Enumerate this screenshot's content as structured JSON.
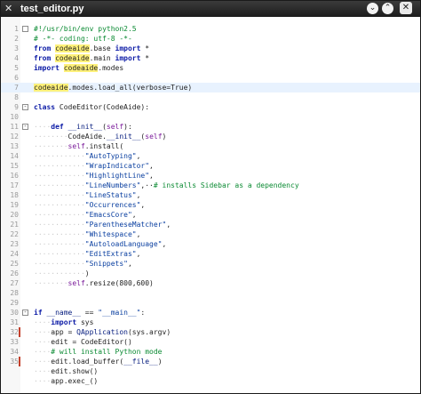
{
  "window": {
    "title": "test_editor.py",
    "app_icon": "x-logo-icon",
    "buttons": [
      {
        "name": "minimize-button",
        "glyph": "⌄"
      },
      {
        "name": "maximize-button",
        "glyph": "⌃"
      },
      {
        "name": "close-button",
        "glyph": "✕"
      }
    ]
  },
  "colors": {
    "keyword": "#0b1aa6",
    "comment": "#0a8a32",
    "string": "#0a3fa0",
    "self": "#7a1a9a",
    "highlight_word": "#fff17a",
    "current_line": "#e8f2fe"
  },
  "editor": {
    "highlighted_line": 7,
    "changed_lines": [
      32,
      35
    ],
    "folded_markers": [
      {
        "line": 1,
        "glyph": ""
      },
      {
        "line": 9,
        "glyph": "-"
      },
      {
        "line": 11,
        "glyph": "-"
      },
      {
        "line": 30,
        "glyph": "-"
      }
    ],
    "lines": [
      {
        "n": "1",
        "tokens": [
          {
            "t": "#!/usr/bin/env python2.5",
            "c": "comment"
          }
        ]
      },
      {
        "n": "2",
        "tokens": [
          {
            "t": "# -*- coding: utf-8 -*-",
            "c": "comment"
          }
        ]
      },
      {
        "n": "3",
        "tokens": [
          {
            "t": "from ",
            "c": "keyword"
          },
          {
            "t": "codeaide",
            "c": "mark"
          },
          {
            "t": ".base ",
            "c": ""
          },
          {
            "t": "import",
            "c": "keyword"
          },
          {
            "t": " *",
            "c": ""
          }
        ]
      },
      {
        "n": "4",
        "tokens": [
          {
            "t": "from ",
            "c": "keyword"
          },
          {
            "t": "codeaide",
            "c": "mark"
          },
          {
            "t": ".main ",
            "c": ""
          },
          {
            "t": "import",
            "c": "keyword"
          },
          {
            "t": " *",
            "c": ""
          }
        ]
      },
      {
        "n": "5",
        "tokens": [
          {
            "t": "import ",
            "c": "keyword"
          },
          {
            "t": "codeaide",
            "c": "mark"
          },
          {
            "t": ".modes",
            "c": ""
          }
        ]
      },
      {
        "n": "6",
        "tokens": []
      },
      {
        "n": "7",
        "tokens": [
          {
            "t": "codeaide",
            "c": "mark"
          },
          {
            "t": ".modes.load_all(verbose=True)",
            "c": ""
          }
        ]
      },
      {
        "n": "8",
        "tokens": []
      },
      {
        "n": "9",
        "tokens": [
          {
            "t": "class ",
            "c": "keyword"
          },
          {
            "t": "CodeEditor(CodeAide):",
            "c": ""
          }
        ]
      },
      {
        "n": "10",
        "tokens": []
      },
      {
        "n": "11",
        "tokens": [
          {
            "t": "····",
            "c": "ws"
          },
          {
            "t": "def ",
            "c": "keyword"
          },
          {
            "t": "__init__",
            "c": "func"
          },
          {
            "t": "(",
            "c": ""
          },
          {
            "t": "self",
            "c": "self"
          },
          {
            "t": "):",
            "c": ""
          }
        ]
      },
      {
        "n": "12",
        "tokens": [
          {
            "t": "········",
            "c": "ws"
          },
          {
            "t": "CodeAide.",
            "c": ""
          },
          {
            "t": "__init__",
            "c": "func"
          },
          {
            "t": "(",
            "c": ""
          },
          {
            "t": "self",
            "c": "self"
          },
          {
            "t": ")",
            "c": ""
          }
        ]
      },
      {
        "n": "13",
        "tokens": [
          {
            "t": "········",
            "c": "ws"
          },
          {
            "t": "self",
            "c": "self"
          },
          {
            "t": ".install(",
            "c": ""
          }
        ]
      },
      {
        "n": "14",
        "tokens": [
          {
            "t": "············",
            "c": "ws"
          },
          {
            "t": "\"AutoTyping\"",
            "c": "string"
          },
          {
            "t": ",",
            "c": ""
          }
        ]
      },
      {
        "n": "15",
        "tokens": [
          {
            "t": "············",
            "c": "ws"
          },
          {
            "t": "\"WrapIndicator\"",
            "c": "string"
          },
          {
            "t": ",",
            "c": ""
          }
        ]
      },
      {
        "n": "16",
        "tokens": [
          {
            "t": "············",
            "c": "ws"
          },
          {
            "t": "\"HighlightLine\"",
            "c": "string"
          },
          {
            "t": ",",
            "c": ""
          }
        ]
      },
      {
        "n": "17",
        "tokens": [
          {
            "t": "············",
            "c": "ws"
          },
          {
            "t": "\"LineNumbers\"",
            "c": "string"
          },
          {
            "t": ",··",
            "c": ""
          },
          {
            "t": "# installs Sidebar as a dependency",
            "c": "comment"
          }
        ]
      },
      {
        "n": "18",
        "tokens": [
          {
            "t": "············",
            "c": "ws"
          },
          {
            "t": "\"LineStatus\"",
            "c": "string"
          },
          {
            "t": ",",
            "c": ""
          }
        ]
      },
      {
        "n": "19",
        "tokens": [
          {
            "t": "············",
            "c": "ws"
          },
          {
            "t": "\"Occurrences\"",
            "c": "string"
          },
          {
            "t": ",",
            "c": ""
          }
        ]
      },
      {
        "n": "20",
        "tokens": [
          {
            "t": "············",
            "c": "ws"
          },
          {
            "t": "\"EmacsCore\"",
            "c": "string"
          },
          {
            "t": ",",
            "c": ""
          }
        ]
      },
      {
        "n": "21",
        "tokens": [
          {
            "t": "············",
            "c": "ws"
          },
          {
            "t": "\"ParentheseMatcher\"",
            "c": "string"
          },
          {
            "t": ",",
            "c": ""
          }
        ]
      },
      {
        "n": "22",
        "tokens": [
          {
            "t": "············",
            "c": "ws"
          },
          {
            "t": "\"Whitespace\"",
            "c": "string"
          },
          {
            "t": ",",
            "c": ""
          }
        ]
      },
      {
        "n": "23",
        "tokens": [
          {
            "t": "············",
            "c": "ws"
          },
          {
            "t": "\"AutoloadLanguage\"",
            "c": "string"
          },
          {
            "t": ",",
            "c": ""
          }
        ]
      },
      {
        "n": "24",
        "tokens": [
          {
            "t": "············",
            "c": "ws"
          },
          {
            "t": "\"EditExtras\"",
            "c": "string"
          },
          {
            "t": ",",
            "c": ""
          }
        ]
      },
      {
        "n": "25",
        "tokens": [
          {
            "t": "············",
            "c": "ws"
          },
          {
            "t": "\"Snippets\"",
            "c": "string"
          },
          {
            "t": ",",
            "c": ""
          }
        ]
      },
      {
        "n": "26",
        "tokens": [
          {
            "t": "············",
            "c": "ws"
          },
          {
            "t": ")",
            "c": ""
          }
        ]
      },
      {
        "n": "27",
        "tokens": [
          {
            "t": "········",
            "c": "ws"
          },
          {
            "t": "self",
            "c": "self"
          },
          {
            "t": ".resize(800,600)",
            "c": ""
          }
        ]
      },
      {
        "n": "28",
        "tokens": []
      },
      {
        "n": "29",
        "tokens": []
      },
      {
        "n": "30",
        "tokens": [
          {
            "t": "if ",
            "c": "keyword"
          },
          {
            "t": "__name__",
            "c": "func"
          },
          {
            "t": " == ",
            "c": ""
          },
          {
            "t": "\"__main__\"",
            "c": "string"
          },
          {
            "t": ":",
            "c": ""
          }
        ]
      },
      {
        "n": "31",
        "tokens": [
          {
            "t": "····",
            "c": "ws"
          },
          {
            "t": "import ",
            "c": "keyword"
          },
          {
            "t": "sys",
            "c": ""
          }
        ]
      },
      {
        "n": "32",
        "tokens": [
          {
            "t": "····",
            "c": "ws"
          },
          {
            "t": "app = ",
            "c": ""
          },
          {
            "t": "QApplication",
            "c": "func"
          },
          {
            "t": "(sys.argv)",
            "c": ""
          }
        ]
      },
      {
        "n": "33",
        "tokens": [
          {
            "t": "····",
            "c": "ws"
          },
          {
            "t": "edit = CodeEditor()",
            "c": ""
          }
        ]
      },
      {
        "n": "34",
        "tokens": [
          {
            "t": "····",
            "c": "ws"
          },
          {
            "t": "# will install Python mode",
            "c": "comment"
          }
        ]
      },
      {
        "n": "35",
        "tokens": [
          {
            "t": "····",
            "c": "ws"
          },
          {
            "t": "edit.load_buffer(",
            "c": ""
          },
          {
            "t": "__file__",
            "c": "func"
          },
          {
            "t": ")",
            "c": ""
          }
        ]
      },
      {
        "n": "",
        "tokens": [
          {
            "t": "····",
            "c": "ws"
          },
          {
            "t": "edit.show()",
            "c": ""
          }
        ]
      },
      {
        "n": "",
        "tokens": [
          {
            "t": "····",
            "c": "ws"
          },
          {
            "t": "app.exec_()",
            "c": ""
          }
        ]
      }
    ]
  }
}
